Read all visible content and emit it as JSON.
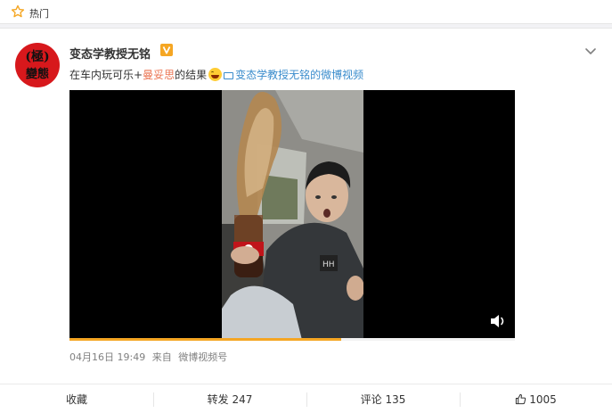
{
  "topbar": {
    "label": "热门",
    "icon": "star-outline-icon"
  },
  "post": {
    "avatar": {
      "line1": "(極)",
      "line2": "變態",
      "color": "#d7181c"
    },
    "username": "变态学教授无铭",
    "verified_badge": "V",
    "text": {
      "part1": "在车内玩可乐+",
      "mention": "曼妥思",
      "part2": "的结果",
      "link": "变态学教授无铭的微博视频"
    },
    "video": {
      "progress": 0.61
    },
    "meta": {
      "date": "04月16日 19:49",
      "source_prefix": "来自",
      "source": "微博视频号"
    }
  },
  "actions": {
    "favorite": "收藏",
    "repost": "转发 247",
    "comment": "评论 135",
    "like": "1005"
  },
  "colors": {
    "accent": "#f5a623",
    "mention": "#eb7350",
    "link": "#3a8ccc"
  }
}
